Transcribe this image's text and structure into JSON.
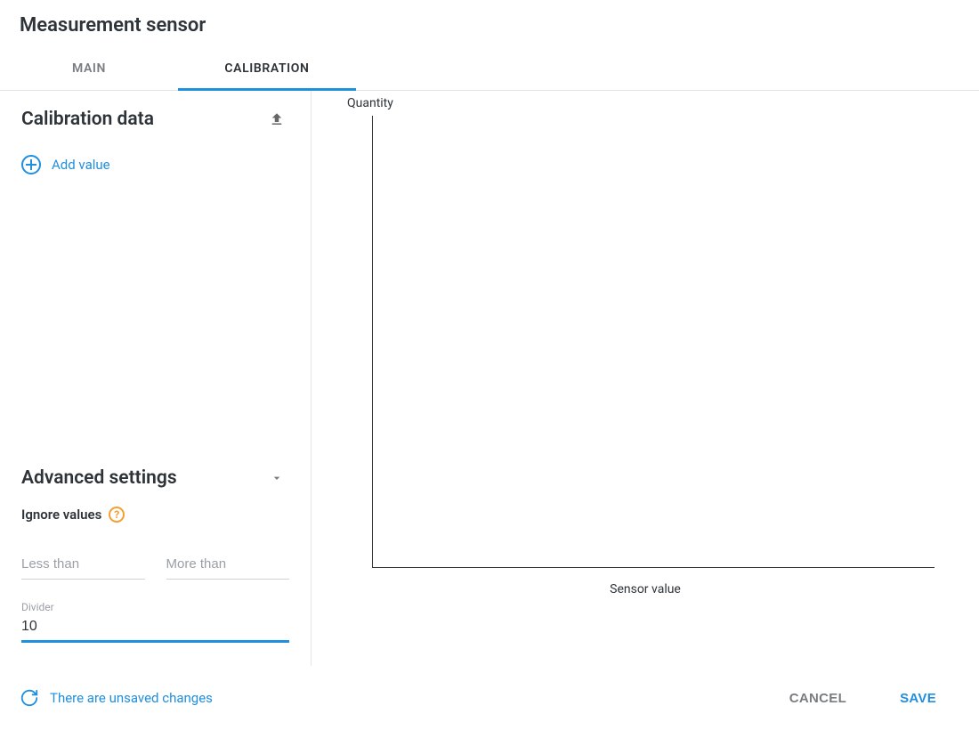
{
  "header": {
    "title": "Measurement sensor"
  },
  "tabs": {
    "main": "MAIN",
    "calibration": "CALIBRATION",
    "active": "calibration"
  },
  "left": {
    "calibration_title": "Calibration data",
    "add_value_label": "Add value",
    "advanced_title": "Advanced settings",
    "ignore_values_label": "Ignore values",
    "less_than_placeholder": "Less than",
    "more_than_placeholder": "More than",
    "divider_label": "Divider",
    "divider_value": "10"
  },
  "chart": {
    "y_label": "Quantity",
    "x_label": "Sensor value"
  },
  "chart_data": {
    "type": "line",
    "title": "",
    "xlabel": "Sensor value",
    "ylabel": "Quantity",
    "x": [],
    "y": [],
    "series": []
  },
  "footer": {
    "unsaved_text": "There are unsaved changes",
    "cancel": "CANCEL",
    "save": "SAVE"
  },
  "colors": {
    "accent": "#1f8fde",
    "warn": "#f59f31",
    "text": "#2d3338",
    "muted": "#797d82",
    "border": "#e3e6e9"
  }
}
